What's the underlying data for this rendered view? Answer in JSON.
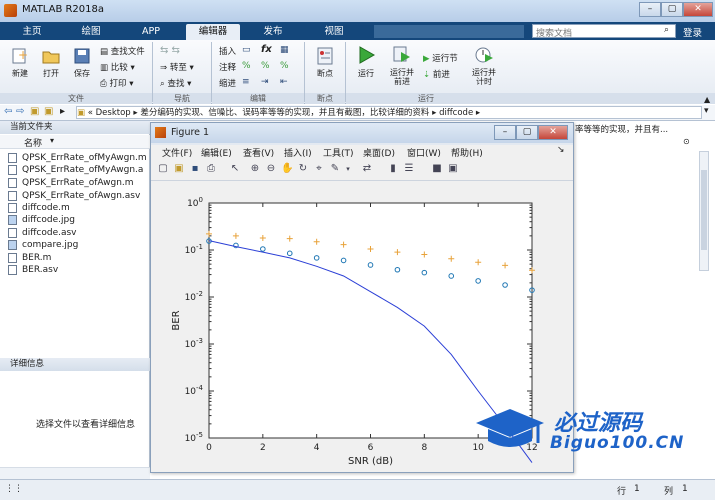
{
  "window": {
    "title": "MATLAB R2018a",
    "search_placeholder": "搜索文档",
    "login": "登录"
  },
  "tabs": [
    {
      "label": "主页",
      "active": false
    },
    {
      "label": "绘图",
      "active": false
    },
    {
      "label": "APP",
      "active": false
    },
    {
      "label": "编辑器",
      "active": true
    },
    {
      "label": "发布",
      "active": false
    },
    {
      "label": "视图",
      "active": false
    }
  ],
  "ribbon": {
    "file": {
      "new": "新建",
      "open": "打开",
      "save": "保存",
      "find_files": "查找文件",
      "compare": "比较",
      "print": "打印",
      "group": "文件"
    },
    "nav": {
      "goto": "转至",
      "find": "查找",
      "group": "导航"
    },
    "edit": {
      "insert": "插入",
      "comment": "注释",
      "indent": "缩进",
      "fx": "fx",
      "group": "编辑"
    },
    "breakpoints": {
      "label": "断点",
      "group": "断点"
    },
    "run": {
      "run": "运行",
      "run_advance": "运行并\n前进",
      "run_section": "运行节",
      "advance": "前进",
      "run_time": "运行并\n计时",
      "group": "运行"
    }
  },
  "address": {
    "prefix": "«",
    "segments": [
      "Desktop",
      "差分编码的实现、信噪比、误码率等等的实现，并且有截图，比较详细的资料",
      "diffcode"
    ]
  },
  "left_panel": {
    "title": "当前文件夹",
    "column": "名称",
    "files": [
      "QPSK_ErrRate_ofMyAwgn.m",
      "QPSK_ErrRate_ofMyAwgn.a",
      "QPSK_ErrRate_ofAwgn.m",
      "QPSK_ErrRate_ofAwgn.asv",
      "diffcode.m",
      "diffcode.jpg",
      "diffcode.asv",
      "compare.jpg",
      "BER.m",
      "BER.asv"
    ],
    "details_title": "详细信息",
    "details_msg": "选择文件以查看详细信息"
  },
  "right_panel": {
    "text": "率等等的实现，并且有..."
  },
  "figure": {
    "title": "Figure 1",
    "menu": [
      "文件(F)",
      "编辑(E)",
      "查看(V)",
      "插入(I)",
      "工具(T)",
      "桌面(D)",
      "窗口(W)",
      "帮助(H)"
    ]
  },
  "status": {
    "row_label": "行",
    "row": "1",
    "col_label": "列",
    "col": "1"
  },
  "watermark": {
    "cn": "必过源码",
    "url": "Biguo100.CN"
  },
  "chart_data": {
    "type": "scatter",
    "xlabel": "SNR (dB)",
    "ylabel": "BER",
    "x_ticks": [
      "0",
      "2",
      "4",
      "6",
      "8",
      "10",
      "12"
    ],
    "y_ticks": [
      "10^0",
      "10^-1",
      "10^-2",
      "10^-3",
      "10^-4",
      "10^-5"
    ],
    "xlim": [
      0,
      12
    ],
    "ylim_log10": [
      -5,
      0
    ],
    "series": [
      {
        "marker": "circle",
        "color": "#1f77b4",
        "x": [
          0,
          1,
          2,
          3,
          4,
          5,
          6,
          7,
          8,
          9,
          10,
          11,
          12
        ],
        "y": [
          0.155,
          0.125,
          0.105,
          0.085,
          0.068,
          0.06,
          0.048,
          0.038,
          0.033,
          0.028,
          0.022,
          0.018,
          0.014
        ]
      },
      {
        "marker": "plus",
        "color": "#e8a23a",
        "x": [
          0,
          1,
          2,
          3,
          4,
          5,
          6,
          7,
          8,
          9,
          10,
          11,
          12
        ],
        "y": [
          0.22,
          0.2,
          0.18,
          0.175,
          0.15,
          0.13,
          0.105,
          0.09,
          0.08,
          0.065,
          0.055,
          0.047,
          0.037
        ]
      },
      {
        "marker": "line",
        "color": "#2b3fd6",
        "x": [
          0,
          1,
          2,
          3,
          4,
          5,
          6,
          7,
          8,
          9,
          10,
          11,
          12
        ],
        "y": [
          0.158,
          0.118,
          0.09,
          0.068,
          0.045,
          0.028,
          0.013,
          0.006,
          0.0024,
          0.0006,
          0.0001,
          1.8e-05,
          3e-06
        ]
      }
    ]
  }
}
